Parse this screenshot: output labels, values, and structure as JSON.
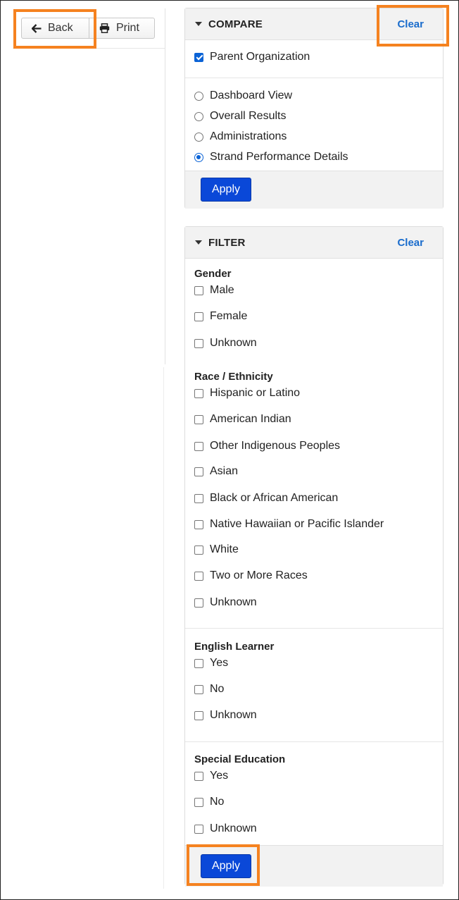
{
  "toolbar": {
    "back_label": "Back",
    "print_label": "Print"
  },
  "compare": {
    "title": "COMPARE",
    "clear_label": "Clear",
    "checkbox": {
      "label": "Parent Organization",
      "checked": true
    },
    "view_options": [
      {
        "label": "Dashboard View",
        "selected": false
      },
      {
        "label": "Overall Results",
        "selected": false
      },
      {
        "label": "Administrations",
        "selected": false
      },
      {
        "label": "Strand Performance Details",
        "selected": true
      }
    ],
    "apply_label": "Apply"
  },
  "filter": {
    "title": "FILTER",
    "clear_label": "Clear",
    "groups": [
      {
        "label": "Gender",
        "options": [
          "Male",
          "Female",
          "Unknown"
        ]
      },
      {
        "label": "Race / Ethnicity",
        "options": [
          "Hispanic or Latino",
          "American Indian",
          "Other Indigenous Peoples",
          "Asian",
          "Black or African American",
          "Native Hawaiian or Pacific Islander",
          "White",
          "Two or More Races",
          "Unknown"
        ]
      },
      {
        "label": "English Learner",
        "options": [
          "Yes",
          "No",
          "Unknown"
        ]
      },
      {
        "label": "Special Education",
        "options": [
          "Yes",
          "No",
          "Unknown"
        ]
      }
    ],
    "apply_label": "Apply"
  },
  "colors": {
    "accent": "#0a48d8",
    "link": "#1a6ccc",
    "highlight": "#f58220",
    "checked": "#0b63d6"
  }
}
